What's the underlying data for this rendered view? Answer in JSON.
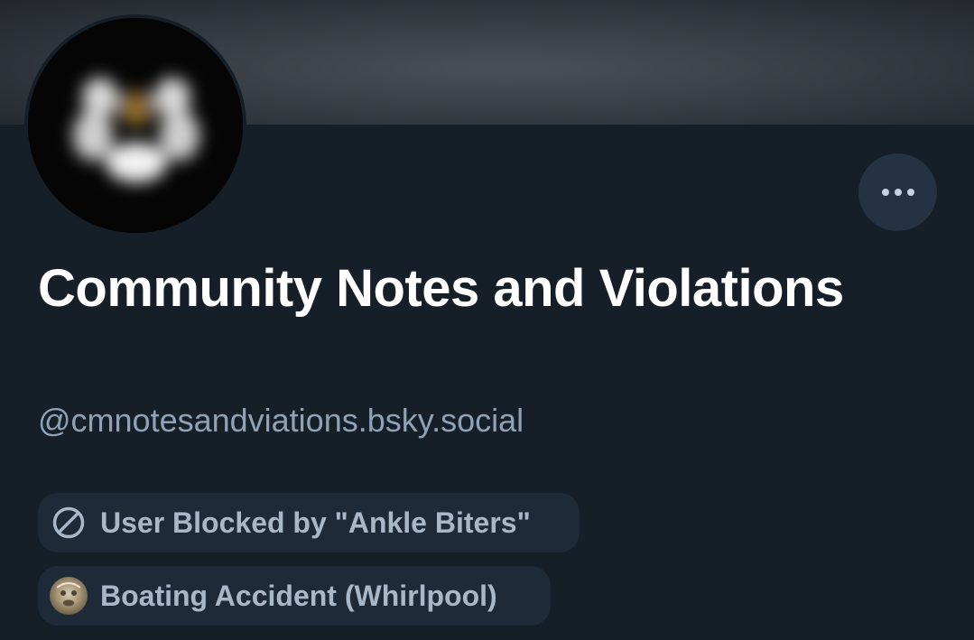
{
  "profile": {
    "display_name": "Community Notes and Violations",
    "handle": "@cmnotesandviations.bsky.social"
  },
  "actions": {
    "more_icon": "ellipsis-icon"
  },
  "labels": [
    {
      "text": "User Blocked by \"Ankle Biters\"",
      "icon": "blocked-icon"
    },
    {
      "text": "Boating Accident (Whirlpool)",
      "icon": "labeler-avatar-icon"
    }
  ],
  "colors": {
    "background": "#161e27",
    "pill_background": "#1e2a38",
    "more_button_background": "#243244",
    "name_text": "#ffffff",
    "muted_text": "#8fa2b8"
  }
}
